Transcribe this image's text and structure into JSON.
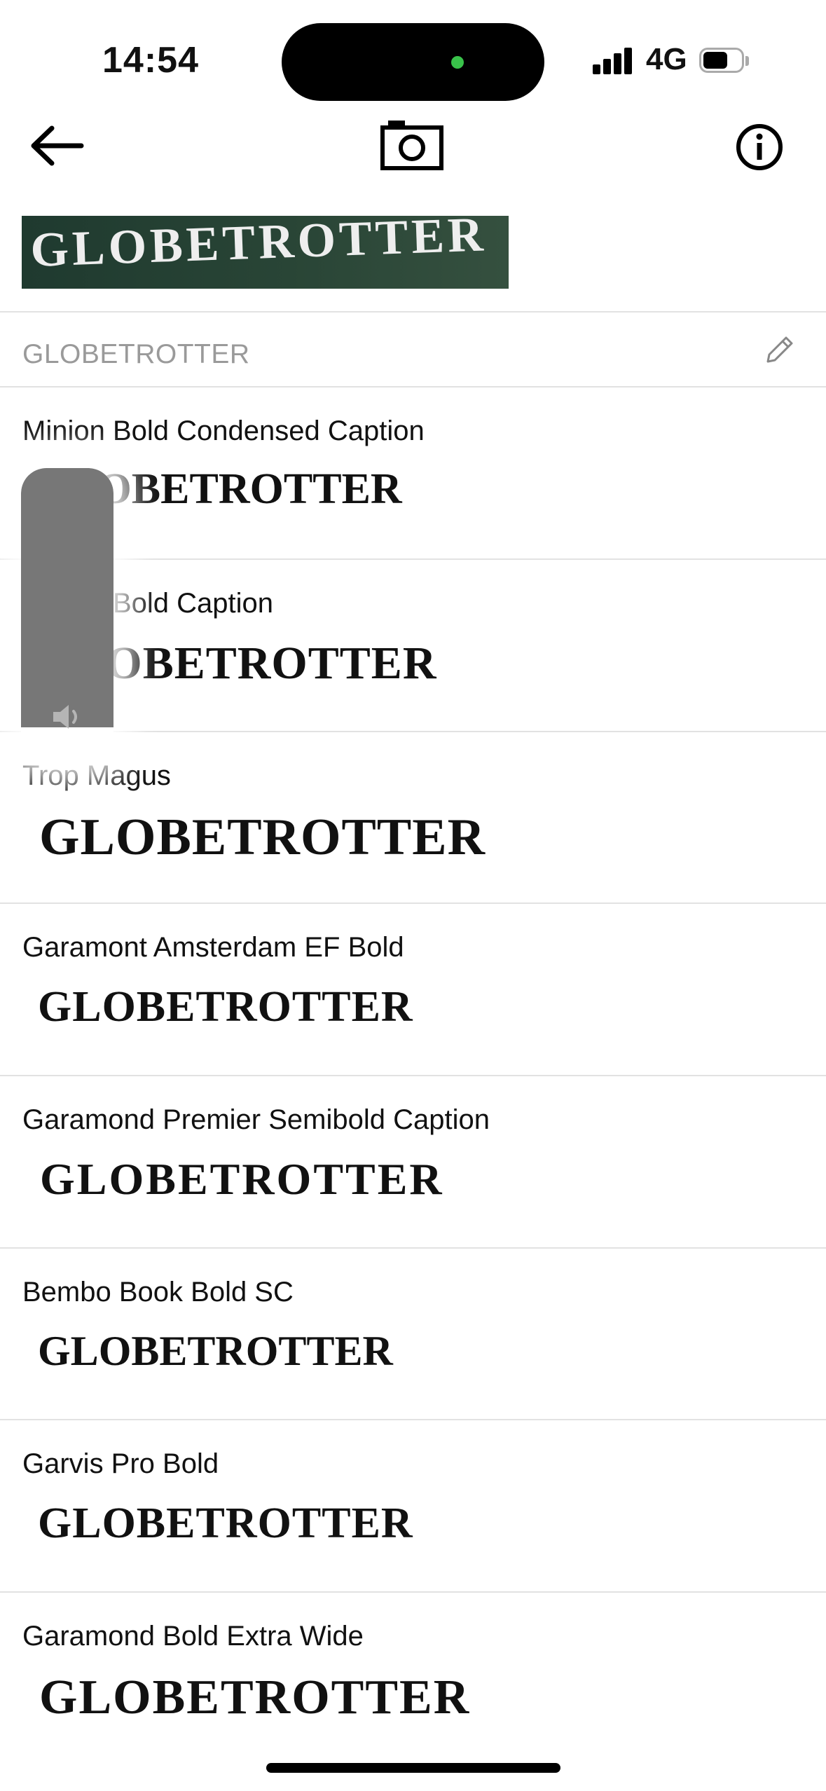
{
  "status_bar": {
    "time": "14:54",
    "network": "4G"
  },
  "toolbar": {
    "back_icon": "arrow-left-icon",
    "camera_icon": "camera-icon",
    "info_icon": "info-circle-icon"
  },
  "sample": {
    "text": "GLOBETROTTER"
  },
  "query": {
    "text": "GLOBETROTTER",
    "edit_icon": "pencil-icon"
  },
  "results": [
    {
      "name": "Minion Bold Condensed Caption",
      "sample": "GLOBETROTTER"
    },
    {
      "name": "Minion Bold Caption",
      "sample": "GLOBETROTTER"
    },
    {
      "name": "Trop Magus",
      "sample": "GLOBETROTTER"
    },
    {
      "name": "Garamont Amsterdam EF Bold",
      "sample": "GLOBETROTTER"
    },
    {
      "name": "Garamond Premier Semibold Caption",
      "sample": "GLOBETROTTER"
    },
    {
      "name": "Bembo Book Bold SC",
      "sample": "GLOBETROTTER"
    },
    {
      "name": "Garvis Pro Bold",
      "sample": "GLOBETROTTER"
    },
    {
      "name": "Garamond Bold Extra Wide",
      "sample": "GLOBETROTTER"
    }
  ],
  "volume_hud": {
    "level": 0.12,
    "icon": "speaker-icon"
  },
  "colors": {
    "accent": "#111111",
    "divider": "#e2e2e2",
    "island_dot": "#39c24a"
  }
}
